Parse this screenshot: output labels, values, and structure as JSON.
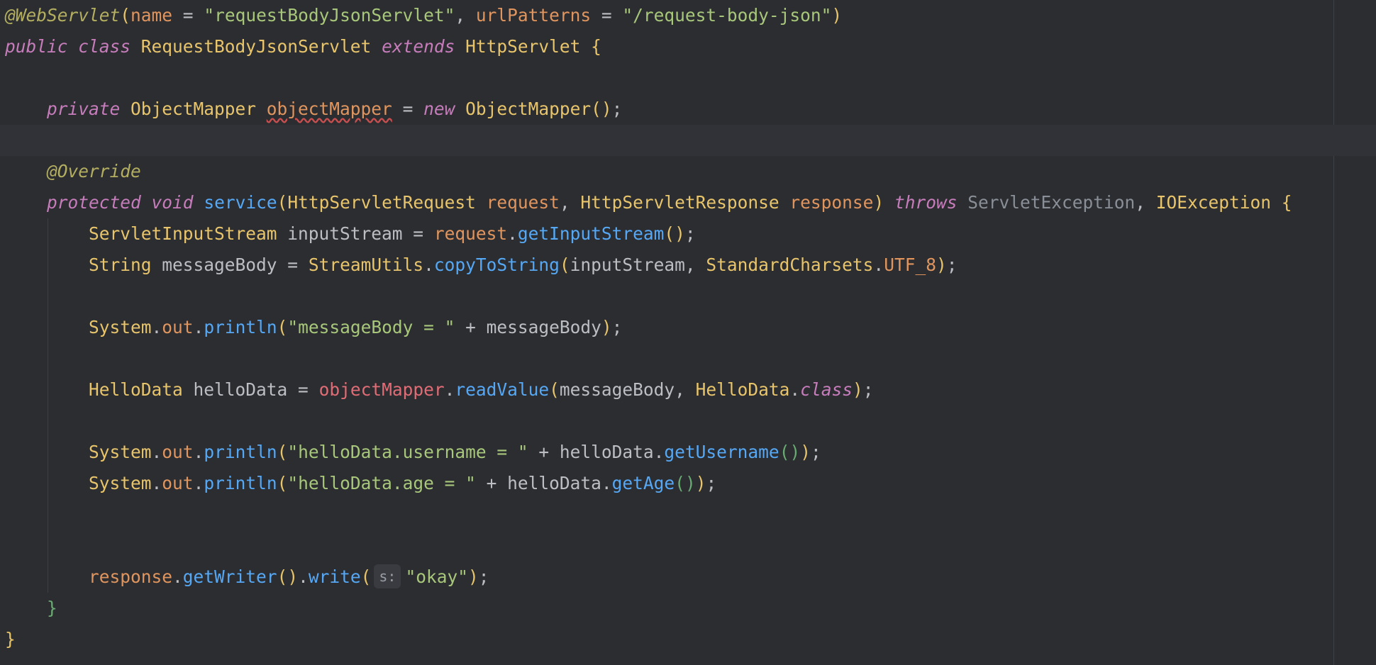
{
  "editor": {
    "language": "java",
    "lines": [
      {
        "id": 1,
        "tokens": [
          {
            "t": "@WebServlet",
            "c": "ann"
          },
          {
            "t": "(",
            "c": "paren"
          },
          {
            "t": "name",
            "c": "param"
          },
          {
            "t": " = ",
            "c": "punc"
          },
          {
            "t": "\"requestBodyJsonServlet\"",
            "c": "str"
          },
          {
            "t": ", ",
            "c": "punc"
          },
          {
            "t": "urlPatterns",
            "c": "param"
          },
          {
            "t": " = ",
            "c": "punc"
          },
          {
            "t": "\"/request-body-json\"",
            "c": "str"
          },
          {
            "t": ")",
            "c": "paren"
          }
        ]
      },
      {
        "id": 2,
        "tokens": [
          {
            "t": "public",
            "c": "kw"
          },
          {
            "t": " ",
            "c": "punc"
          },
          {
            "t": "class",
            "c": "kw"
          },
          {
            "t": " RequestBodyJsonServlet ",
            "c": "ty"
          },
          {
            "t": "extends",
            "c": "kw"
          },
          {
            "t": " HttpServlet ",
            "c": "ty"
          },
          {
            "t": "{",
            "c": "paren"
          }
        ]
      },
      {
        "id": 3,
        "tokens": []
      },
      {
        "id": 4,
        "tokens": [
          {
            "t": "    ",
            "c": "punc"
          },
          {
            "t": "private",
            "c": "kw"
          },
          {
            "t": " ObjectMapper ",
            "c": "ty"
          },
          {
            "t": "objectMapper",
            "c": "warn"
          },
          {
            "t": " = ",
            "c": "punc"
          },
          {
            "t": "new",
            "c": "kw"
          },
          {
            "t": " ObjectMapper",
            "c": "ty"
          },
          {
            "t": "()",
            "c": "paren"
          },
          {
            "t": ";",
            "c": "punc"
          }
        ]
      },
      {
        "id": 5,
        "tokens": [],
        "caret": true
      },
      {
        "id": 6,
        "tokens": [
          {
            "t": "    ",
            "c": "punc"
          },
          {
            "t": "@Override",
            "c": "ann"
          }
        ]
      },
      {
        "id": 7,
        "tokens": [
          {
            "t": "    ",
            "c": "punc"
          },
          {
            "t": "protected",
            "c": "kw"
          },
          {
            "t": " ",
            "c": "punc"
          },
          {
            "t": "void",
            "c": "kw"
          },
          {
            "t": " ",
            "c": "punc"
          },
          {
            "t": "service",
            "c": "fn"
          },
          {
            "t": "(",
            "c": "paren"
          },
          {
            "t": "HttpServletRequest ",
            "c": "ty"
          },
          {
            "t": "request",
            "c": "param"
          },
          {
            "t": ", ",
            "c": "punc"
          },
          {
            "t": "HttpServletResponse ",
            "c": "ty"
          },
          {
            "t": "response",
            "c": "param"
          },
          {
            "t": ") ",
            "c": "paren"
          },
          {
            "t": "throws",
            "c": "kw"
          },
          {
            "t": " ServletException",
            "c": "dim"
          },
          {
            "t": ", ",
            "c": "punc"
          },
          {
            "t": "IOException ",
            "c": "ty"
          },
          {
            "t": "{",
            "c": "paren"
          }
        ]
      },
      {
        "id": 8,
        "tokens": [
          {
            "t": "        ",
            "c": "punc"
          },
          {
            "t": "ServletInputStream ",
            "c": "ty"
          },
          {
            "t": "inputStream",
            "c": "var"
          },
          {
            "t": " = ",
            "c": "punc"
          },
          {
            "t": "request",
            "c": "param"
          },
          {
            "t": ".",
            "c": "punc"
          },
          {
            "t": "getInputStream",
            "c": "fn"
          },
          {
            "t": "()",
            "c": "paren"
          },
          {
            "t": ";",
            "c": "punc"
          }
        ]
      },
      {
        "id": 9,
        "tokens": [
          {
            "t": "        ",
            "c": "punc"
          },
          {
            "t": "String ",
            "c": "ty"
          },
          {
            "t": "messageBody",
            "c": "var"
          },
          {
            "t": " = ",
            "c": "punc"
          },
          {
            "t": "StreamUtils",
            "c": "ty"
          },
          {
            "t": ".",
            "c": "punc"
          },
          {
            "t": "copyToString",
            "c": "fn"
          },
          {
            "t": "(",
            "c": "paren"
          },
          {
            "t": "inputStream",
            "c": "var"
          },
          {
            "t": ", ",
            "c": "punc"
          },
          {
            "t": "StandardCharsets",
            "c": "ty"
          },
          {
            "t": ".",
            "c": "punc"
          },
          {
            "t": "UTF_8",
            "c": "const"
          },
          {
            "t": ")",
            "c": "paren"
          },
          {
            "t": ";",
            "c": "punc"
          }
        ]
      },
      {
        "id": 10,
        "tokens": []
      },
      {
        "id": 11,
        "tokens": [
          {
            "t": "        ",
            "c": "punc"
          },
          {
            "t": "System",
            "c": "ty"
          },
          {
            "t": ".",
            "c": "punc"
          },
          {
            "t": "out",
            "c": "field"
          },
          {
            "t": ".",
            "c": "punc"
          },
          {
            "t": "println",
            "c": "fn"
          },
          {
            "t": "(",
            "c": "paren"
          },
          {
            "t": "\"messageBody = \"",
            "c": "str"
          },
          {
            "t": " + ",
            "c": "punc"
          },
          {
            "t": "messageBody",
            "c": "var"
          },
          {
            "t": ")",
            "c": "paren"
          },
          {
            "t": ";",
            "c": "punc"
          }
        ]
      },
      {
        "id": 12,
        "tokens": []
      },
      {
        "id": 13,
        "tokens": [
          {
            "t": "        ",
            "c": "punc"
          },
          {
            "t": "HelloData ",
            "c": "ty"
          },
          {
            "t": "helloData",
            "c": "var"
          },
          {
            "t": " = ",
            "c": "punc"
          },
          {
            "t": "objectMapper",
            "c": "field-red"
          },
          {
            "t": ".",
            "c": "punc"
          },
          {
            "t": "readValue",
            "c": "fn"
          },
          {
            "t": "(",
            "c": "paren"
          },
          {
            "t": "messageBody",
            "c": "var"
          },
          {
            "t": ", ",
            "c": "punc"
          },
          {
            "t": "HelloData",
            "c": "ty"
          },
          {
            "t": ".",
            "c": "punc"
          },
          {
            "t": "class",
            "c": "kw"
          },
          {
            "t": ")",
            "c": "paren"
          },
          {
            "t": ";",
            "c": "punc"
          }
        ]
      },
      {
        "id": 14,
        "tokens": []
      },
      {
        "id": 15,
        "tokens": [
          {
            "t": "        ",
            "c": "punc"
          },
          {
            "t": "System",
            "c": "ty"
          },
          {
            "t": ".",
            "c": "punc"
          },
          {
            "t": "out",
            "c": "field"
          },
          {
            "t": ".",
            "c": "punc"
          },
          {
            "t": "println",
            "c": "fn"
          },
          {
            "t": "(",
            "c": "paren"
          },
          {
            "t": "\"helloData.username = \"",
            "c": "str"
          },
          {
            "t": " + ",
            "c": "punc"
          },
          {
            "t": "helloData",
            "c": "var"
          },
          {
            "t": ".",
            "c": "punc"
          },
          {
            "t": "getUsername",
            "c": "fn"
          },
          {
            "t": "()",
            "c": "paren3"
          },
          {
            "t": ")",
            "c": "paren"
          },
          {
            "t": ";",
            "c": "punc"
          }
        ]
      },
      {
        "id": 16,
        "tokens": [
          {
            "t": "        ",
            "c": "punc"
          },
          {
            "t": "System",
            "c": "ty"
          },
          {
            "t": ".",
            "c": "punc"
          },
          {
            "t": "out",
            "c": "field"
          },
          {
            "t": ".",
            "c": "punc"
          },
          {
            "t": "println",
            "c": "fn"
          },
          {
            "t": "(",
            "c": "paren"
          },
          {
            "t": "\"helloData.age = \"",
            "c": "str"
          },
          {
            "t": " + ",
            "c": "punc"
          },
          {
            "t": "helloData",
            "c": "var"
          },
          {
            "t": ".",
            "c": "punc"
          },
          {
            "t": "getAge",
            "c": "fn"
          },
          {
            "t": "()",
            "c": "paren3"
          },
          {
            "t": ")",
            "c": "paren"
          },
          {
            "t": ";",
            "c": "punc"
          }
        ]
      },
      {
        "id": 17,
        "tokens": []
      },
      {
        "id": 18,
        "tokens": []
      },
      {
        "id": 19,
        "tokens": [
          {
            "t": "        ",
            "c": "punc"
          },
          {
            "t": "response",
            "c": "param"
          },
          {
            "t": ".",
            "c": "punc"
          },
          {
            "t": "getWriter",
            "c": "fn"
          },
          {
            "t": "()",
            "c": "paren"
          },
          {
            "t": ".",
            "c": "punc"
          },
          {
            "t": "write",
            "c": "fn"
          },
          {
            "t": "(",
            "c": "paren"
          },
          {
            "t": "s:",
            "c": "hint"
          },
          {
            "t": "\"okay\"",
            "c": "str"
          },
          {
            "t": ")",
            "c": "paren"
          },
          {
            "t": ";",
            "c": "punc"
          }
        ]
      },
      {
        "id": 20,
        "tokens": [
          {
            "t": "    ",
            "c": "punc"
          },
          {
            "t": "}",
            "c": "paren3"
          }
        ]
      },
      {
        "id": 21,
        "tokens": [
          {
            "t": "}",
            "c": "paren"
          }
        ]
      }
    ]
  }
}
